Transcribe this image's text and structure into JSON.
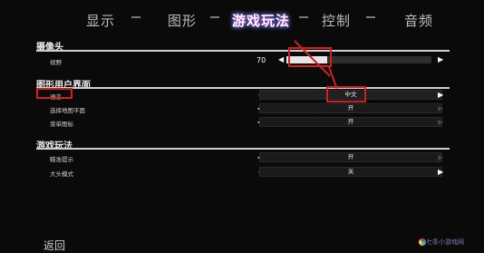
{
  "tabs": [
    {
      "label": "显示"
    },
    {
      "label": "图形"
    },
    {
      "label": "游戏玩法",
      "active": true
    },
    {
      "label": "控制"
    },
    {
      "label": "音频"
    }
  ],
  "sections": {
    "camera": {
      "title": "摄像头",
      "fov": {
        "label": "视野",
        "value": "70",
        "level_fraction": 0.28
      }
    },
    "ui": {
      "title": "图形用户界面",
      "language": {
        "label": "语言",
        "value": "中文"
      },
      "radar": {
        "label": "选择地图平面",
        "value": "开"
      },
      "reticle": {
        "label": "菜单图标",
        "value": "开"
      }
    },
    "gameplay": {
      "title": "游戏玩法",
      "aim": {
        "label": "瞄准提示",
        "value": "开"
      },
      "head": {
        "label": "大头模式",
        "value": "关"
      }
    }
  },
  "footer": {
    "back_label": "返回"
  },
  "watermark": "七条小游戏网",
  "colors": {
    "highlight_red": "#d02020",
    "background": "#0a0a0a"
  }
}
